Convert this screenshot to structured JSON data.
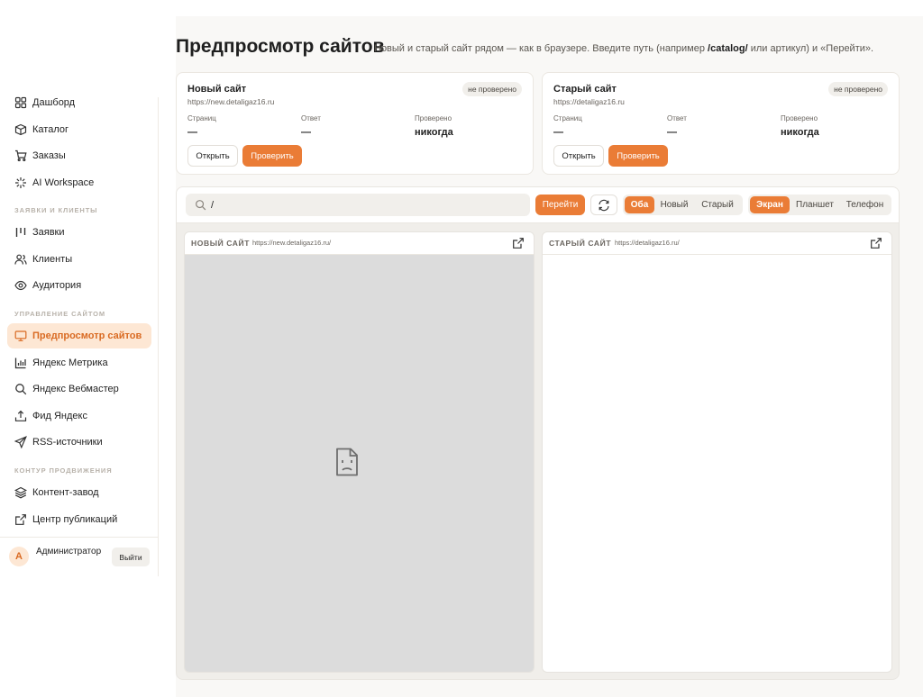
{
  "sidebar": {
    "items": [
      {
        "label": "Дашборд",
        "icon": "grid-icon"
      },
      {
        "label": "Каталог",
        "icon": "box-icon"
      },
      {
        "label": "Заказы",
        "icon": "cart-icon"
      },
      {
        "label": "AI Workspace",
        "icon": "sparkle-icon"
      },
      {
        "label": "Заявки",
        "icon": "kanban-icon"
      },
      {
        "label": "Клиенты",
        "icon": "users-icon"
      },
      {
        "label": "Аудитория",
        "icon": "eye-icon"
      },
      {
        "label": "Предпросмотр сайтов",
        "icon": "monitor-icon",
        "active": true
      },
      {
        "label": "Яндекс Метрика",
        "icon": "bar-chart-icon"
      },
      {
        "label": "Яндекс Вебмастер",
        "icon": "search-icon"
      },
      {
        "label": "Фид Яндекс",
        "icon": "upload-icon"
      },
      {
        "label": "RSS-источники",
        "icon": "send-icon"
      },
      {
        "label": "Контент-завод",
        "icon": "layers-icon"
      },
      {
        "label": "Центр публикаций",
        "icon": "external-link-icon"
      }
    ],
    "sections": {
      "leads": "ЗАЯВКИ И КЛИЕНТЫ",
      "sites": "УПРАВЛЕНИЕ САЙТОМ",
      "promo": "КОНТУР ПРОДВИЖЕНИЯ"
    },
    "user": {
      "initial": "А",
      "name": "Администратор",
      "logout": "Выйти"
    }
  },
  "page": {
    "title": "Предпросмотр сайтов",
    "subtitle_pre": "Новый и старый сайт рядом — как в браузере. Введите путь (например ",
    "subtitle_code": "/catalog/",
    "subtitle_post": " или артикул) и «Перейти»."
  },
  "cards": [
    {
      "title": "Новый сайт",
      "url": "https://new.detaligaz16.ru",
      "badge": "не проверено",
      "stats": [
        {
          "label": "Страниц",
          "value": "—"
        },
        {
          "label": "Ответ",
          "value": "—"
        },
        {
          "label": "Проверено",
          "value": "никогда"
        }
      ],
      "open_label": "Открыть",
      "check_label": "Проверить"
    },
    {
      "title": "Старый сайт",
      "url": "https://detaligaz16.ru",
      "badge": "не проверено",
      "stats": [
        {
          "label": "Страниц",
          "value": "—"
        },
        {
          "label": "Ответ",
          "value": "—"
        },
        {
          "label": "Проверено",
          "value": "никогда"
        }
      ],
      "open_label": "Открыть",
      "check_label": "Проверить"
    }
  ],
  "toolbar": {
    "path_value": "/",
    "go_label": "Перейти",
    "site_mode": {
      "options": [
        "Оба",
        "Новый",
        "Старый"
      ],
      "selected": "Оба"
    },
    "device_mode": {
      "options": [
        "Экран",
        "Планшет",
        "Телефон"
      ],
      "selected": "Экран"
    }
  },
  "panes": [
    {
      "name": "НОВЫЙ САЙТ",
      "url": "https://new.detaligaz16.ru/",
      "state": "error",
      "background": "#dcdcdc"
    },
    {
      "name": "СТАРЫЙ САЙТ",
      "url": "https://detaligaz16.ru/",
      "state": "blank",
      "background": "#ffffff"
    }
  ],
  "colors": {
    "accent": "#ea7c36",
    "accent_soft": "#fde7d4",
    "page_bg": "#f9f8f6"
  }
}
